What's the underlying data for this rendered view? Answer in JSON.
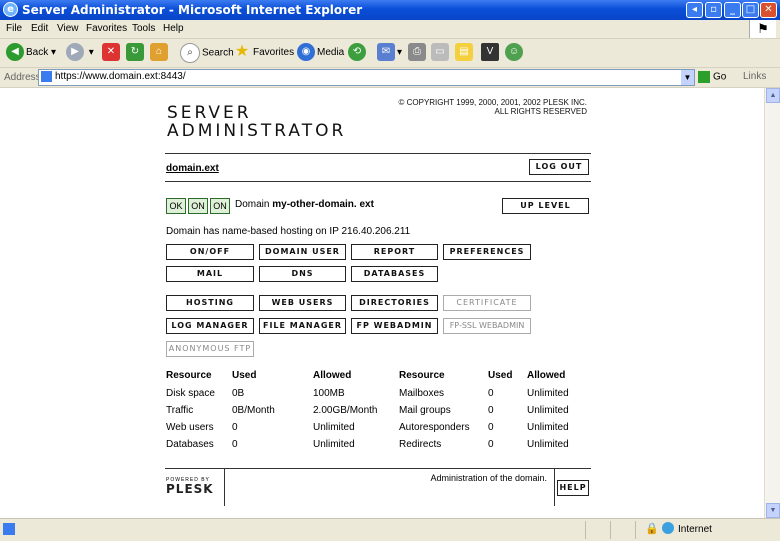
{
  "window": {
    "title": "Server Administrator - Microsoft Internet Explorer"
  },
  "menu": [
    "File",
    "Edit",
    "View",
    "Favorites",
    "Tools",
    "Help"
  ],
  "toolbar": {
    "back": "Back",
    "search": "Search",
    "favorites": "Favorites",
    "media": "Media"
  },
  "address": {
    "label": "Address",
    "url": "https://www.domain.ext:8443/",
    "go": "Go",
    "links": "Links"
  },
  "header": {
    "brand_line1": "SERVER",
    "brand_line2": "ADMINISTRATOR",
    "copyright_line1": "© COPYRIGHT 1999, 2000, 2001, 2002 PLESK INC.",
    "copyright_line2": "ALL RIGHTS RESERVED"
  },
  "nav": {
    "domain_link": "domain.ext",
    "logout": "LOG OUT",
    "up_level": "UP LEVEL"
  },
  "status": {
    "badges": [
      "OK",
      "ON",
      "ON"
    ],
    "domain_prefix": "Domain",
    "domain_name": "my-other-domain. ext",
    "hosting_info": "Domain has name-based hosting on IP 216.40.206.211"
  },
  "buttons": {
    "on_off": "ON/OFF",
    "domain_user": "DOMAIN USER",
    "report": "REPORT",
    "preferences": "PREFERENCES",
    "mail": "MAIL",
    "dns": "DNS",
    "databases": "DATABASES",
    "hosting": "HOSTING",
    "web_users": "WEB USERS",
    "directories": "DIRECTORIES",
    "certificate": "CERTIFICATE",
    "log_manager": "LOG MANAGER",
    "file_manager": "FILE MANAGER",
    "fp_webadmin": "FP WEBADMIN",
    "fp_ssl_webadmin": "FP-SSL WEBADMIN",
    "anonymous_ftp": "ANONYMOUS FTP"
  },
  "resources": {
    "headers": [
      "Resource",
      "Used",
      "Allowed",
      "Resource",
      "Used",
      "Allowed"
    ],
    "rows": [
      [
        "Disk space",
        "0B",
        "100MB",
        "Mailboxes",
        "0",
        "Unlimited"
      ],
      [
        "Traffic",
        "0B/Month",
        "2.00GB/Month",
        "Mail groups",
        "0",
        "Unlimited"
      ],
      [
        "Web users",
        "0",
        "Unlimited",
        "Autoresponders",
        "0",
        "Unlimited"
      ],
      [
        "Databases",
        "0",
        "Unlimited",
        "Redirects",
        "0",
        "Unlimited"
      ]
    ]
  },
  "footer": {
    "powered_by": "POWERED BY",
    "plesk": "PLESK",
    "note": "Administration of the domain.",
    "help": "HELP"
  },
  "statusbar": {
    "zone": "Internet"
  }
}
